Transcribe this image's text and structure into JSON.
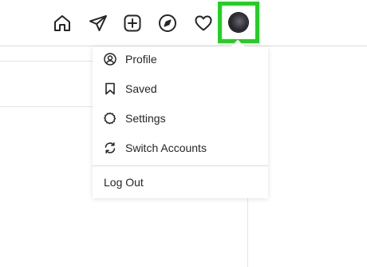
{
  "nav": {
    "icons": [
      "home-icon",
      "direct-message-icon",
      "new-post-icon",
      "explore-icon",
      "activity-heart-icon",
      "profile-avatar"
    ],
    "highlight_color": "#1fd21f"
  },
  "menu": {
    "items": [
      {
        "label": "Profile",
        "icon": "user-circle-icon"
      },
      {
        "label": "Saved",
        "icon": "bookmark-icon"
      },
      {
        "label": "Settings",
        "icon": "gear-icon"
      },
      {
        "label": "Switch Accounts",
        "icon": "switch-arrows-icon"
      }
    ],
    "logout_label": "Log Out"
  }
}
